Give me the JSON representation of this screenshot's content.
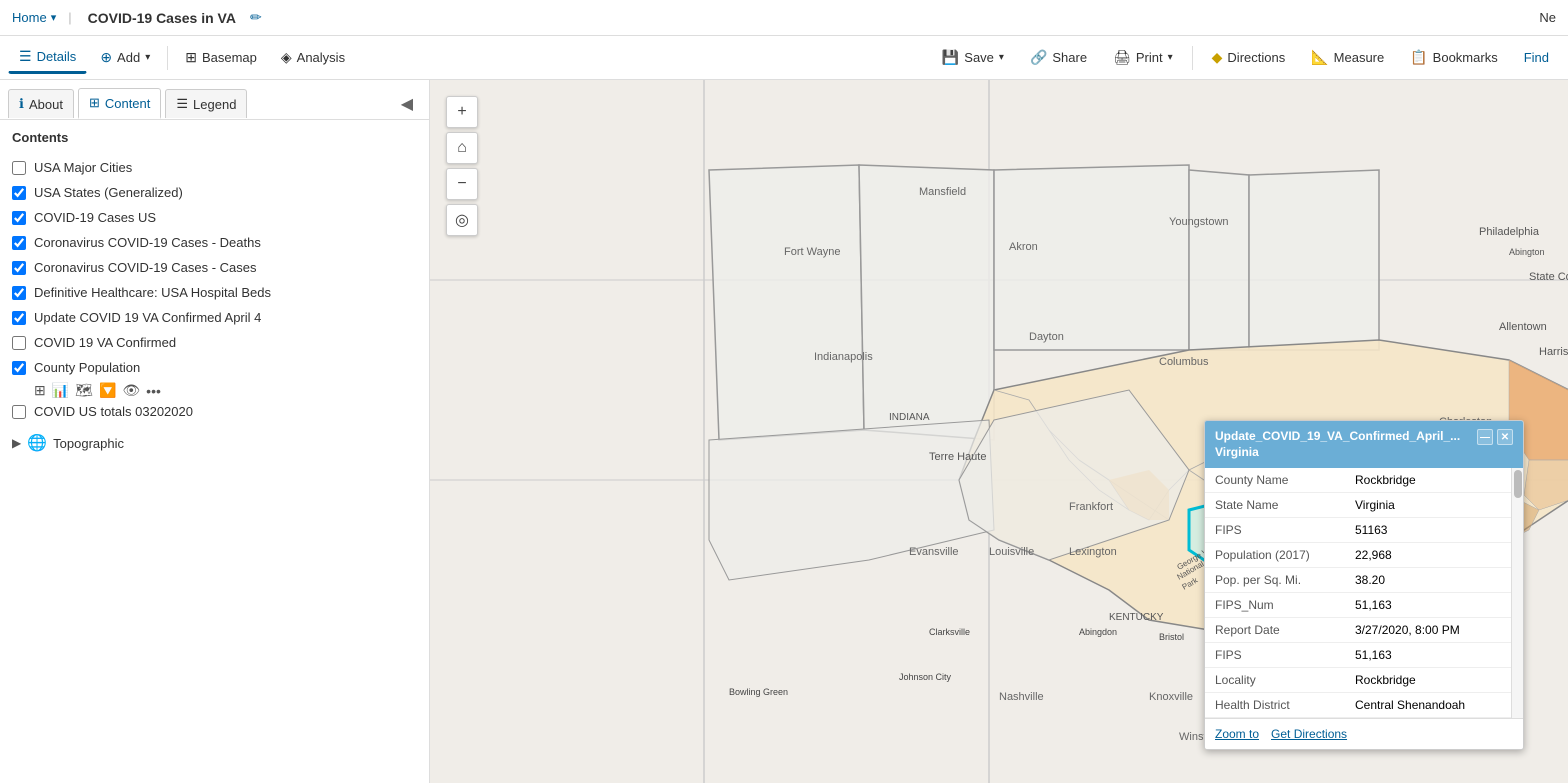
{
  "topbar": {
    "home_label": "Home",
    "home_chevron": "▾",
    "title": "COVID-19 Cases in VA",
    "edit_icon": "✏",
    "right_text": "Ne"
  },
  "toolbar": {
    "details_label": "Details",
    "add_label": "Add",
    "add_icon": "+",
    "basemap_label": "Basemap",
    "analysis_label": "Analysis",
    "save_label": "Save",
    "share_label": "Share",
    "print_label": "Print",
    "directions_label": "Directions",
    "measure_label": "Measure",
    "bookmarks_label": "Bookmarks",
    "find_label": "Find"
  },
  "sidebar": {
    "about_label": "About",
    "content_label": "Content",
    "legend_label": "Legend",
    "contents_heading": "Contents",
    "collapse_icon": "◀",
    "layers": [
      {
        "id": "usa-major-cities",
        "label": "USA Major Cities",
        "checked": false,
        "has_sub": false
      },
      {
        "id": "usa-states-generalized",
        "label": "USA States (Generalized)",
        "checked": true,
        "has_sub": false
      },
      {
        "id": "covid19-cases-us",
        "label": "COVID-19 Cases US",
        "checked": true,
        "has_sub": false
      },
      {
        "id": "coronavirus-deaths",
        "label": "Coronavirus COVID-19 Cases - Deaths",
        "checked": true,
        "has_sub": false
      },
      {
        "id": "coronavirus-cases",
        "label": "Coronavirus COVID-19 Cases - Cases",
        "checked": true,
        "has_sub": false
      },
      {
        "id": "hospital-beds",
        "label": "Definitive Healthcare: USA Hospital Beds",
        "checked": true,
        "has_sub": false
      },
      {
        "id": "update-covid-va",
        "label": "Update COVID 19 VA Confirmed April 4",
        "checked": true,
        "has_sub": false
      },
      {
        "id": "covid-va-confirmed",
        "label": "COVID 19 VA Confirmed",
        "checked": false,
        "has_sub": false
      },
      {
        "id": "county-population",
        "label": "County Population",
        "checked": true,
        "has_sub": true
      },
      {
        "id": "covid-us-totals",
        "label": "COVID US totals 03202020",
        "checked": false,
        "has_sub": false
      }
    ],
    "topographic_label": "Topographic",
    "topographic_icon": "🌐"
  },
  "map_controls": {
    "zoom_in": "+",
    "home": "⌂",
    "zoom_out": "−",
    "location": "◎"
  },
  "popup": {
    "title": "Update_COVID_19_VA_Confirmed_April_... Virginia",
    "minimize_icon": "—",
    "close_icon": "✕",
    "fields": [
      {
        "key": "County Name",
        "value": "Rockbridge"
      },
      {
        "key": "State Name",
        "value": "Virginia"
      },
      {
        "key": "FIPS",
        "value": "51163"
      },
      {
        "key": "Population (2017)",
        "value": "22,968"
      },
      {
        "key": "Pop. per Sq. Mi.",
        "value": "38.20"
      },
      {
        "key": "FIPS_Num",
        "value": "51,163"
      },
      {
        "key": "Report Date",
        "value": "3/27/2020, 8:00 PM"
      },
      {
        "key": "FIPS",
        "value": "51,163"
      },
      {
        "key": "Locality",
        "value": "Rockbridge"
      },
      {
        "key": "Health District",
        "value": "Central Shenandoah"
      }
    ],
    "zoom_to_label": "Zoom to",
    "get_directions_label": "Get Directions"
  }
}
